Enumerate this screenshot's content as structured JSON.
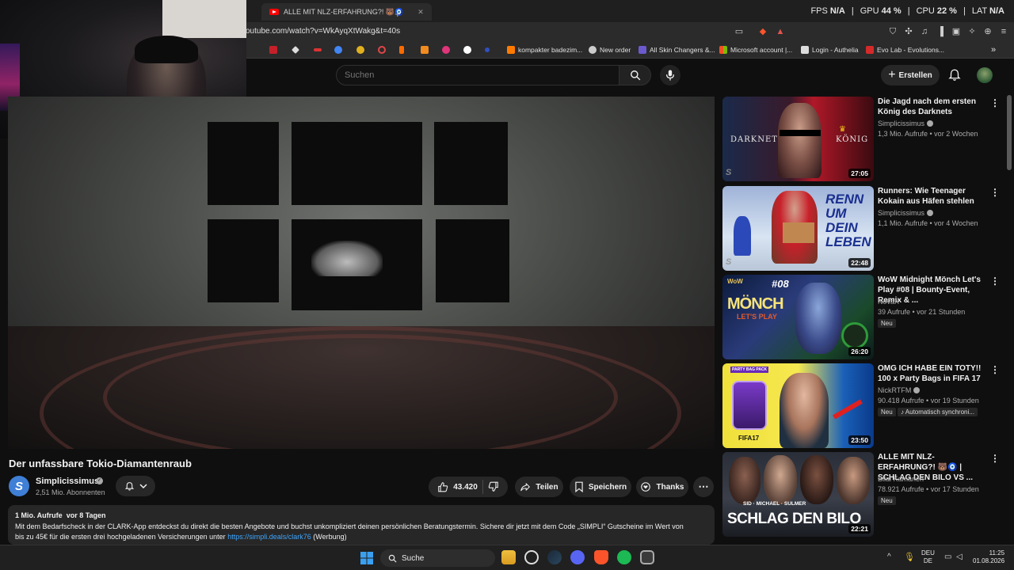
{
  "browser": {
    "tab_title": "ALLE MIT NLZ-ERFAHRUNG?! 🐻🧿",
    "url": "outube.com/watch?v=WkAyqXtWakg&t=40s",
    "stats": {
      "fps_label": "FPS",
      "fps": "N/A",
      "gpu_label": "GPU",
      "gpu": "44 %",
      "cpu_label": "CPU",
      "cpu": "22 %",
      "lat_label": "LAT",
      "lat": "N/A"
    },
    "bookmarks": [
      "kompakter badezim...",
      "New order",
      "All Skin Changers &...",
      "Microsoft account |...",
      "Login - Authelia",
      "Evo Lab - Evolutions..."
    ]
  },
  "youtube": {
    "search_placeholder": "Suchen",
    "create_label": "Erstellen",
    "video": {
      "title": "Der unfassbare Tokio-Diamantenraub",
      "channel": "Simplicissimus",
      "channel_initial": "S",
      "subscribers": "2,51 Mio. Abonnenten",
      "likes": "43.420",
      "share_label": "Teilen",
      "save_label": "Speichern",
      "thanks_label": "Thanks",
      "description": {
        "views": "1 Mio. Aufrufe",
        "age": "vor 8 Tagen",
        "line1": "Mit dem Bedarfscheck in der CLARK-App entdeckst du direkt die besten Angebote und buchst unkompliziert deinen persönlichen Beratungstermin. Sichere dir jetzt mit dem Code „SIMPLI“ Gutscheine im Wert von",
        "line2_prefix": "bis zu 45€ für die ersten drei hochgeladenen Versicherungen unter ",
        "link": "https://simpli.deals/clark76",
        "line2_suffix": " (Werbung)"
      }
    },
    "recommendations": [
      {
        "title": "Die Jagd nach dem ersten König des Darknets",
        "channel": "Simplicissimus",
        "verified": true,
        "meta": "1,3 Mio. Aufrufe • vor 2 Wochen",
        "duration": "27:05",
        "thumb_left": "DARKNET",
        "thumb_right": "KÖNIG"
      },
      {
        "title": "Runners: Wie Teenager Kokain aus Häfen stehlen",
        "channel": "Simplicissimus",
        "verified": true,
        "meta": "1,1 Mio. Aufrufe • vor 4 Wochen",
        "duration": "22:48",
        "thumb_text": "RENN UM DEIN LEBEN"
      },
      {
        "title": "WoW Midnight Mönch Let's Play #08 | Bounty-Event, Remix & ...",
        "channel": "NovaX",
        "verified": false,
        "meta": "39 Aufrufe • vor 21 Stunden",
        "badge": "Neu",
        "duration": "26:20",
        "thumb_text": "MÖNCH",
        "thumb_sub": "LET'S PLAY",
        "thumb_num": "#08"
      },
      {
        "title": "OMG ICH HABE EIN TOTY!! 100 x Party Bags in FIFA 17",
        "channel": "NickRTFM",
        "verified": true,
        "meta": "90.418 Aufrufe • vor 19 Stunden",
        "badge": "Neu",
        "badge2": "Automatisch synchroni...",
        "duration": "23:50",
        "thumb_text": "PARTY BAG PACK"
      },
      {
        "title": "ALLE MIT NLZ-ERFAHRUNG?! 🐻🧿 | SCHLAG DEN BILO VS ...",
        "channel": "Bilal Kamarieh",
        "verified": false,
        "meta": "78.921 Aufrufe • vor 17 Stunden",
        "badge": "Neu",
        "duration": "22:21",
        "thumb_text": "SCHLAG DEN BILO",
        "thumb_sub": "SID · MICHAEL · SULMER"
      }
    ]
  },
  "taskbar": {
    "search_label": "Suche",
    "lang": "DEU",
    "region": "DE",
    "time": "11:25",
    "date": "01.08.2026"
  },
  "colors": {
    "accent_red": "#ff0000",
    "link": "#3ea6ff",
    "background": "#0f0f0f"
  }
}
